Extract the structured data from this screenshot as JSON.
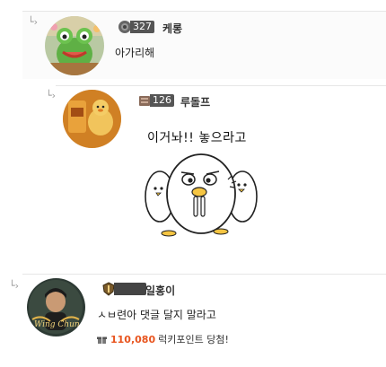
{
  "comments": [
    {
      "level": "327",
      "nickname": "케롱",
      "text": "아가리해"
    },
    {
      "level": "126",
      "nickname": "루돌프",
      "sticker_text": "이거놔!! 놓으라고"
    },
    {
      "level": "",
      "nickname": "일홍이",
      "text": "ㅅㅂ련아 댓글 달지 말라고",
      "avatar_caption": "Wing Chun",
      "lucky_points": "110,080",
      "lucky_label": "럭키포인트 당첨!"
    }
  ],
  "icons": {
    "reply": "reply-arrow-icon",
    "gift": "gift-icon"
  },
  "colors": {
    "lucky_number": "#e8541e",
    "level_bg": "#555555"
  }
}
